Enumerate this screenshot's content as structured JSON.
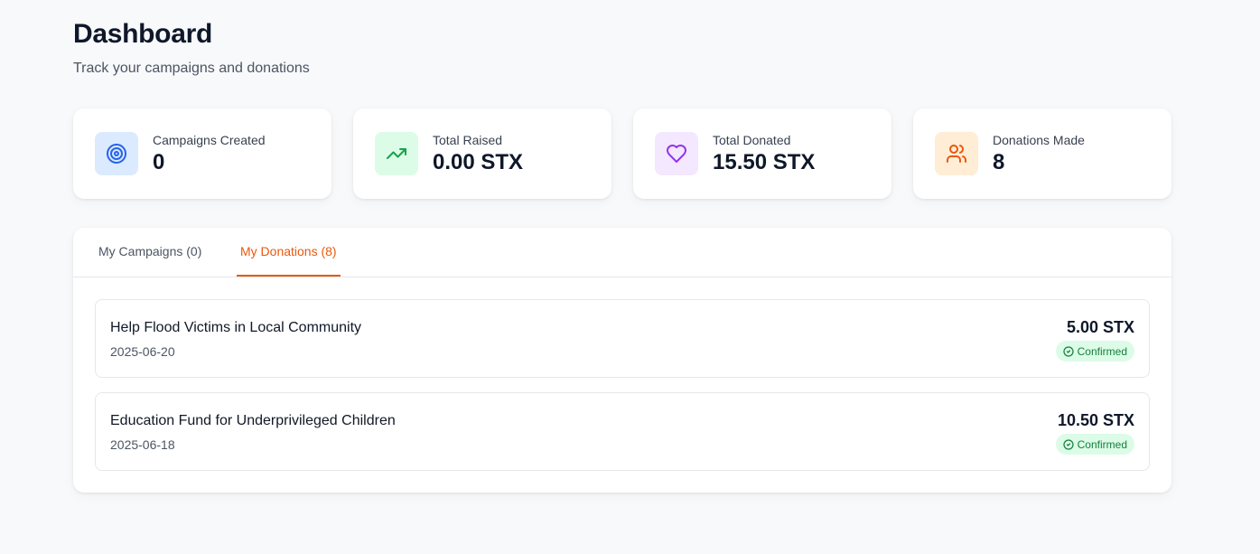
{
  "header": {
    "title": "Dashboard",
    "subtitle": "Track your campaigns and donations"
  },
  "stats": [
    {
      "label": "Campaigns Created",
      "value": "0",
      "icon": "target-icon",
      "color": "#2563eb",
      "bg": "#dbeafe"
    },
    {
      "label": "Total Raised",
      "value": "0.00 STX",
      "icon": "trending-up-icon",
      "color": "#16a34a",
      "bg": "#dcfce7"
    },
    {
      "label": "Total Donated",
      "value": "15.50 STX",
      "icon": "heart-icon",
      "color": "#9333ea",
      "bg": "#f3e8ff"
    },
    {
      "label": "Donations Made",
      "value": "8",
      "icon": "users-icon",
      "color": "#ea580c",
      "bg": "#ffedd5"
    }
  ],
  "tabs": [
    {
      "label": "My Campaigns (0)",
      "active": false
    },
    {
      "label": "My Donations (8)",
      "active": true
    }
  ],
  "donations": [
    {
      "title": "Help Flood Victims in Local Community",
      "date": "2025-06-20",
      "amount": "5.00 STX",
      "status": "Confirmed"
    },
    {
      "title": "Education Fund for Underprivileged Children",
      "date": "2025-06-18",
      "amount": "10.50 STX",
      "status": "Confirmed"
    }
  ],
  "colors": {
    "accent": "#ea580c",
    "confirmed_bg": "#dcfce7",
    "confirmed_text": "#15803d"
  }
}
